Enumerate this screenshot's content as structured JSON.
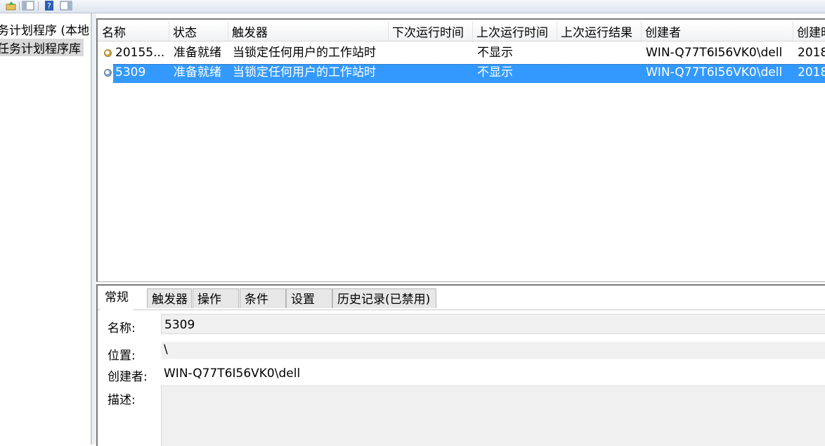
{
  "toolbar": {
    "buttons": [
      "folder-up-icon",
      "show-hide-tree-icon",
      "help-icon",
      "show-hide-action-pane-icon"
    ]
  },
  "tree": {
    "items": [
      {
        "label": "务计划程序 (本地"
      },
      {
        "label": "任务计划程序库"
      }
    ]
  },
  "list": {
    "columns": [
      "名称",
      "状态",
      "触发器",
      "下次运行时间",
      "上次运行时间",
      "上次运行结果",
      "创建者",
      "创建时"
    ],
    "rows": [
      {
        "name": "20155...",
        "status": "准备就绪",
        "trigger": "当锁定任何用户的工作站时",
        "next_run": "",
        "last_run": "不显示",
        "last_result": "",
        "author": "WIN-Q77T6I56VK0\\dell",
        "created": "2018"
      },
      {
        "name": "5309",
        "status": "准备就绪",
        "trigger": "当锁定任何用户的工作站时",
        "next_run": "",
        "last_run": "不显示",
        "last_result": "",
        "author": "WIN-Q77T6I56VK0\\dell",
        "created": "2018"
      }
    ]
  },
  "detail": {
    "tabs": [
      "常规",
      "触发器",
      "操作",
      "条件",
      "设置",
      "历史记录(已禁用)"
    ],
    "name_label": "名称:",
    "name_value": "5309",
    "location_label": "位置:",
    "location_value": "\\",
    "author_label": "创建者:",
    "author_value": "WIN-Q77T6I56VK0\\dell",
    "description_label": "描述:"
  },
  "colors": {
    "selection": "#3399ff",
    "tab_inactive": "#e7e7e7"
  }
}
